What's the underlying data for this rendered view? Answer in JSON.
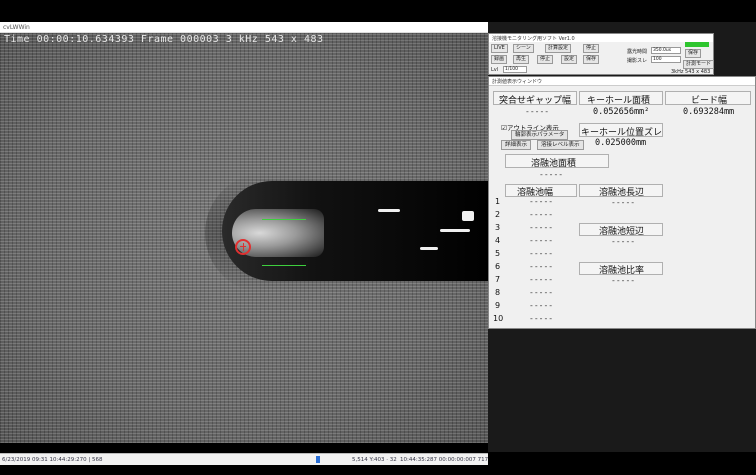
{
  "camera": {
    "window_title": "cvLWWin",
    "overlay": "Time 00:00:10.634393  Frame 000003  3 kHz  543 x 483",
    "status": {
      "left": "6/23/2019 09:31 10:44:29:270  |  568",
      "mid": "5,514 Y:403  ·  32",
      "right": "10:44:35:287 00:00:00:007  717"
    }
  },
  "control_panel": {
    "title": "溶接機モニタリング用ソフト Ver1.0",
    "buttons": {
      "live": "LIVE",
      "scene": "シーン",
      "record": "録画",
      "stop": "停止",
      "play": "再生",
      "pause": "停止",
      "settings": "設定",
      "save": "保存",
      "calc_setting": "計算設定",
      "detail_mode": "計測モード"
    },
    "labels": {
      "lvl": "Lvl",
      "shutter": "1/100",
      "exposure_label": "露光時間",
      "exposure_value": "350.0us",
      "interval_label": "撮影スレ",
      "interval_value": "100",
      "resolution": "3kHz  543 x 483"
    },
    "colors": {
      "indicator": "#2ec52e"
    }
  },
  "measurement": {
    "window_title": "計測値表示ウィンドウ",
    "gap_width": {
      "label": "突合せギャップ幅",
      "value": "-----"
    },
    "keyhole_area": {
      "label": "キーホール面積",
      "value": "0.052656mm²"
    },
    "bead_width": {
      "label": "ビード幅",
      "value": "0.693284mm"
    },
    "outline": {
      "label": "☑アウトライン表示",
      "param_button": "輪郭表示パラメータ"
    },
    "detail_button": "詳細表示",
    "brightness_button": "溶接レベル表示",
    "keyhole_offset": {
      "label": "キーホール位置ズレ",
      "value": "0.025000mm"
    },
    "pool_area": {
      "label": "溶融池面積",
      "value": "-----"
    },
    "pool_width": {
      "label": "溶融池幅"
    },
    "pool_long": {
      "label": "溶融池長辺",
      "value": "-----"
    },
    "pool_short": {
      "label": "溶融池短辺",
      "value": "-----"
    },
    "pool_ratio": {
      "label": "溶融池比率",
      "value": "-----"
    },
    "rows": [
      {
        "n": "1",
        "v": "-----"
      },
      {
        "n": "2",
        "v": "-----"
      },
      {
        "n": "3",
        "v": "-----"
      },
      {
        "n": "4",
        "v": "-----"
      },
      {
        "n": "5",
        "v": "-----"
      },
      {
        "n": "6",
        "v": "-----"
      },
      {
        "n": "7",
        "v": "-----"
      },
      {
        "n": "8",
        "v": "-----"
      },
      {
        "n": "9",
        "v": "-----"
      },
      {
        "n": "10",
        "v": "-----"
      }
    ]
  }
}
